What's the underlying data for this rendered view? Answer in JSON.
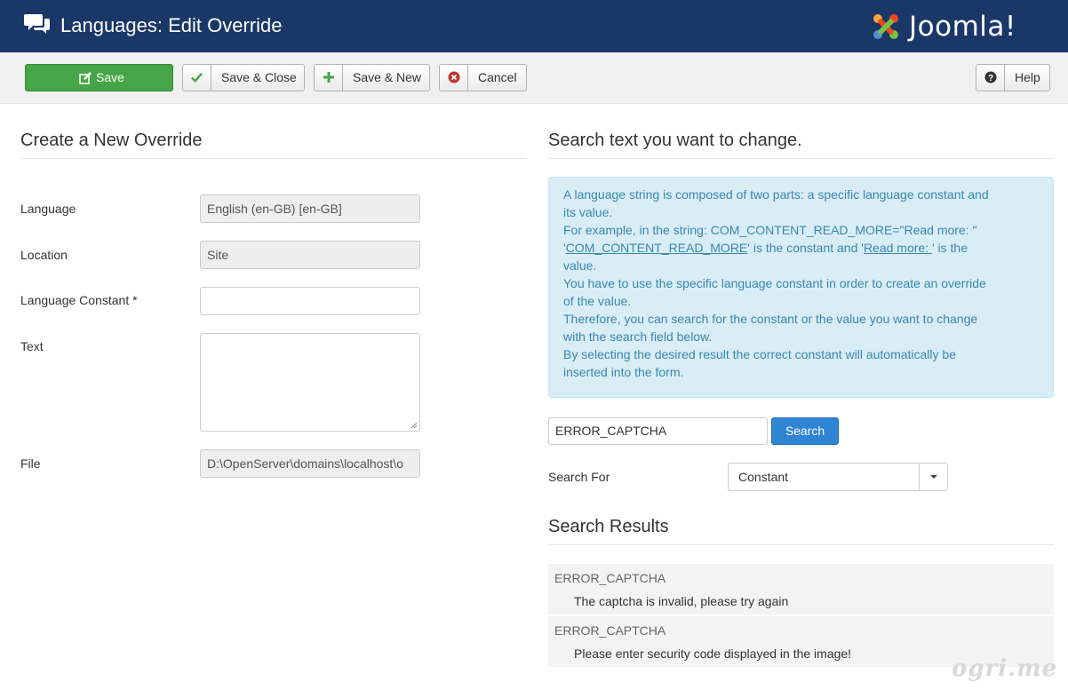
{
  "header": {
    "title": "Languages: Edit Override",
    "icon": "comments-icon",
    "logo_text": "Joomla!"
  },
  "toolbar": {
    "save_label": "Save",
    "save_close_label": "Save & Close",
    "save_new_label": "Save & New",
    "cancel_label": "Cancel",
    "help_label": "Help"
  },
  "form": {
    "title": "Create a New Override",
    "language_label": "Language",
    "language_value": "English (en-GB) [en-GB]",
    "location_label": "Location",
    "location_value": "Site",
    "constant_label": "Language Constant *",
    "constant_value": "",
    "text_label": "Text",
    "text_value": "",
    "file_label": "File",
    "file_value": "D:\\OpenServer\\domains\\localhost\\o"
  },
  "search": {
    "title": "Search text you want to change.",
    "info_lines": [
      "A language string is composed of two parts: a specific language constant and",
      "its value.",
      "For example, in the string: COM_CONTENT_READ_MORE=\"Read more: \"",
      "is the constant and",
      "is the",
      "value.",
      "You have to use the specific language constant in order to create an override",
      "of the value.",
      "Therefore, you can search for the constant or the value you want to change",
      "with the search field below.",
      "By selecting the desired result the correct constant will automatically be",
      "inserted into the form."
    ],
    "info_constant_link": "COM_CONTENT_READ_MORE",
    "info_value_link": "Read more: ",
    "query": "ERROR_CAPTCHA",
    "button_label": "Search",
    "search_for_label": "Search For",
    "search_for_value": "Constant",
    "results_title": "Search Results",
    "results": [
      {
        "constant": "ERROR_CAPTCHA",
        "value": "The captcha is invalid, please try again"
      },
      {
        "constant": "ERROR_CAPTCHA",
        "value": "Please enter security code displayed in the image!"
      }
    ]
  },
  "watermark": "ogri.me",
  "colors": {
    "header_bg": "#1a3867",
    "save_green": "#46a546",
    "search_blue": "#2f84d3",
    "info_bg": "#d9edf7",
    "info_text": "#3a87ad"
  }
}
